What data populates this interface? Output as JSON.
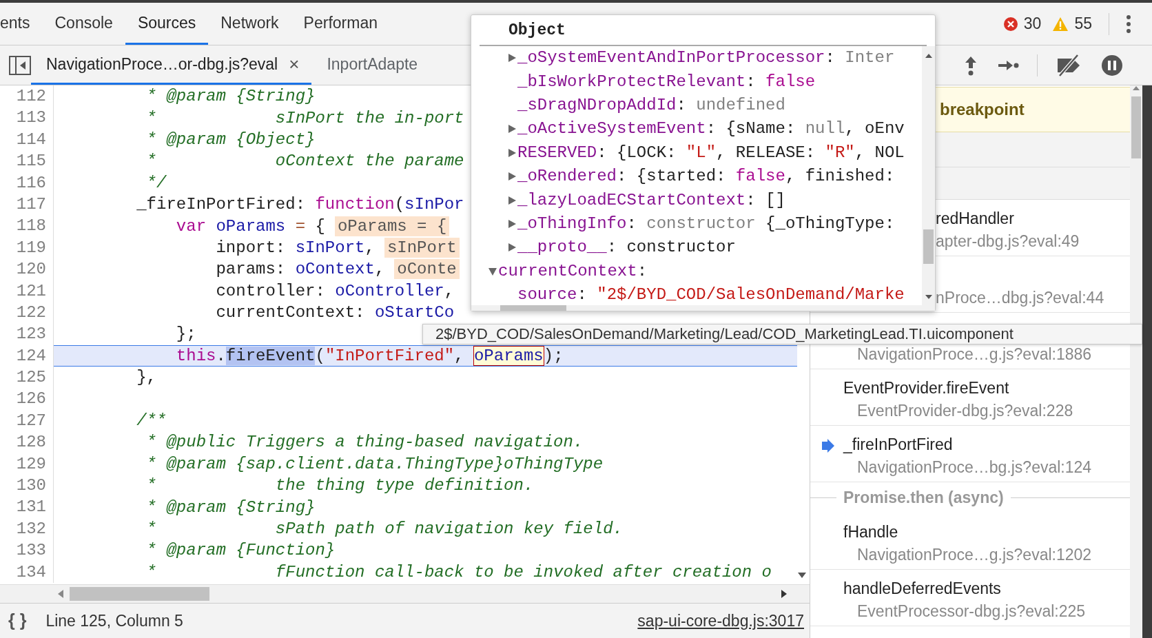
{
  "tabs": [
    {
      "label": "ents",
      "selected": false
    },
    {
      "label": "Console",
      "selected": false
    },
    {
      "label": "Sources",
      "selected": true
    },
    {
      "label": "Network",
      "selected": false
    },
    {
      "label": "Performan",
      "selected": false
    }
  ],
  "counters": {
    "errors": "30",
    "warnings": "55"
  },
  "file_tabs": [
    {
      "label": "NavigationProce…or-dbg.js?eval",
      "selected": true,
      "close": "×"
    },
    {
      "label": "InportAdapte",
      "selected": false
    }
  ],
  "editor": {
    "lines": [
      {
        "number": "112",
        "current": false,
        "tokens": [
          {
            "kind": "comment",
            "text": "         * @param {String}"
          }
        ]
      },
      {
        "number": "113",
        "current": false,
        "tokens": [
          {
            "kind": "comment",
            "text": "         *            sInPort the in-port"
          }
        ]
      },
      {
        "number": "114",
        "current": false,
        "tokens": [
          {
            "kind": "comment",
            "text": "         * @param {Object}"
          }
        ]
      },
      {
        "number": "115",
        "current": false,
        "tokens": [
          {
            "kind": "comment",
            "text": "         *            oContext the parame"
          }
        ]
      },
      {
        "number": "116",
        "current": false,
        "tokens": [
          {
            "kind": "comment",
            "text": "         */"
          }
        ]
      },
      {
        "number": "117",
        "current": false,
        "tokens": [
          {
            "kind": "plain",
            "text": "        _fireInPortFired: "
          },
          {
            "kind": "keyword",
            "text": "function"
          },
          {
            "kind": "plain",
            "text": "("
          },
          {
            "kind": "def",
            "text": "sInPor"
          }
        ]
      },
      {
        "number": "118",
        "current": false,
        "tokens": [
          {
            "kind": "keyword",
            "text": "            var"
          },
          {
            "kind": "def",
            "text": " oParams"
          },
          {
            "kind": "op",
            "text": " = "
          },
          {
            "kind": "plain",
            "text": "{"
          }
        ],
        "inline_value": "oParams = {"
      },
      {
        "number": "119",
        "current": false,
        "tokens": [
          {
            "kind": "plain",
            "text": "                inport: "
          },
          {
            "kind": "def",
            "text": "sInPort"
          },
          {
            "kind": "plain",
            "text": ","
          }
        ],
        "inline_value": "sInPort"
      },
      {
        "number": "120",
        "current": false,
        "tokens": [
          {
            "kind": "plain",
            "text": "                params: "
          },
          {
            "kind": "def",
            "text": "oContext"
          },
          {
            "kind": "plain",
            "text": ","
          }
        ],
        "inline_value": "oConte"
      },
      {
        "number": "121",
        "current": false,
        "tokens": [
          {
            "kind": "plain",
            "text": "                controller: "
          },
          {
            "kind": "def",
            "text": "oController"
          },
          {
            "kind": "plain",
            "text": ","
          }
        ]
      },
      {
        "number": "122",
        "current": false,
        "tokens": [
          {
            "kind": "plain",
            "text": "                currentContext: "
          },
          {
            "kind": "def",
            "text": "oStartCo"
          }
        ]
      },
      {
        "number": "123",
        "current": false,
        "tokens": [
          {
            "kind": "plain",
            "text": "            };"
          }
        ]
      },
      {
        "number": "124",
        "current": true,
        "tokens": [
          {
            "kind": "keyword",
            "text": "            this"
          },
          {
            "kind": "plain",
            "text": "."
          },
          {
            "kind": "match",
            "text": "fireEvent"
          },
          {
            "kind": "plain",
            "text": "("
          },
          {
            "kind": "string",
            "text": "\"InPortFired\""
          },
          {
            "kind": "plain",
            "text": ", "
          },
          {
            "kind": "hover",
            "text": "oParams"
          },
          {
            "kind": "plain",
            "text": ");"
          }
        ]
      },
      {
        "number": "125",
        "current": false,
        "tokens": [
          {
            "kind": "plain",
            "text": "        },"
          }
        ]
      },
      {
        "number": "126",
        "current": false
      },
      {
        "number": "127",
        "current": false,
        "tokens": [
          {
            "kind": "comment",
            "text": "        /**"
          }
        ]
      },
      {
        "number": "128",
        "current": false,
        "tokens": [
          {
            "kind": "comment",
            "text": "         * @public Triggers a thing-based navigation."
          }
        ]
      },
      {
        "number": "129",
        "current": false,
        "tokens": [
          {
            "kind": "comment",
            "text": "         * @param {sap.client.data.ThingType}oThingType"
          }
        ]
      },
      {
        "number": "130",
        "current": false,
        "tokens": [
          {
            "kind": "comment",
            "text": "         *            the thing type definition."
          }
        ]
      },
      {
        "number": "131",
        "current": false,
        "tokens": [
          {
            "kind": "comment",
            "text": "         * @param {String}"
          }
        ]
      },
      {
        "number": "132",
        "current": false,
        "tokens": [
          {
            "kind": "comment",
            "text": "         *            sPath path of navigation key field."
          }
        ]
      },
      {
        "number": "133",
        "current": false,
        "tokens": [
          {
            "kind": "comment",
            "text": "         * @param {Function}"
          }
        ]
      },
      {
        "number": "134",
        "current": false,
        "tokens": [
          {
            "kind": "comment",
            "text": "         *            fFunction call-back to be invoked after creation o"
          }
        ]
      }
    ]
  },
  "status_bar": {
    "format_button": "{ }",
    "position": "Line 125, Column 5",
    "source_link": "sap-ui-core-dbg.js:3017"
  },
  "debugger": {
    "paused_banner": "breakpoint",
    "call_stack": [
      {
        "kind": "frame",
        "name": "redHandler",
        "location": "apter-dbg.js?eval:49",
        "selected": false
      },
      {
        "kind": "frame",
        "location": "nProce…dbg.js?eval:44",
        "selected": false
      },
      {
        "kind": "frame",
        "location": "NavigationProce…g.js?eval:1886",
        "selected": false
      },
      {
        "kind": "frame",
        "name": "EventProvider.fireEvent",
        "location": "EventProvider-dbg.js?eval:228",
        "selected": false
      },
      {
        "kind": "frame",
        "name": "_fireInPortFired",
        "location": "NavigationProce…bg.js?eval:124",
        "selected": true
      },
      {
        "kind": "async",
        "label": "Promise.then (async)"
      },
      {
        "kind": "frame",
        "name": "fHandle",
        "location": "NavigationProce…g.js?eval:1202",
        "selected": false
      },
      {
        "kind": "frame",
        "name": "handleDeferredEvents",
        "location": "EventProcessor-dbg.js?eval:225",
        "selected": false
      }
    ]
  },
  "popover": {
    "title": "Object",
    "tree": [
      {
        "children": [
          {
            "key": "_oSystemEventAndInPortProcessor",
            "expanded": false,
            "value": [
              {
                "kind": "plain",
                "text": ": "
              },
              {
                "kind": "dim",
                "text": "Inter"
              }
            ]
          },
          {
            "key": "_bIsWorkProtectRelevant",
            "value": [
              {
                "kind": "plain",
                "text": ": "
              },
              {
                "kind": "keyword",
                "text": "false"
              }
            ]
          },
          {
            "key": "_sDragNDropAddId",
            "value": [
              {
                "kind": "plain",
                "text": ": "
              },
              {
                "kind": "dim",
                "text": "undefined"
              }
            ]
          },
          {
            "key": "_oActiveSystemEvent",
            "expanded": false,
            "value": [
              {
                "kind": "plain",
                "text": ": {sName: "
              },
              {
                "kind": "dim",
                "text": "null"
              },
              {
                "kind": "plain",
                "text": ", oEnv"
              }
            ]
          },
          {
            "key": "RESERVED",
            "expanded": false,
            "value": [
              {
                "kind": "plain",
                "text": ": {LOCK: "
              },
              {
                "kind": "string",
                "text": "\"L\""
              },
              {
                "kind": "plain",
                "text": ", RELEASE: "
              },
              {
                "kind": "string",
                "text": "\"R\""
              },
              {
                "kind": "plain",
                "text": ", NOL"
              }
            ]
          },
          {
            "key": "_oRendered",
            "expanded": false,
            "value": [
              {
                "kind": "plain",
                "text": ": {started: "
              },
              {
                "kind": "keyword",
                "text": "false"
              },
              {
                "kind": "plain",
                "text": ", finished:"
              }
            ]
          },
          {
            "key": "_lazyLoadECStartContext",
            "expanded": false,
            "value": [
              {
                "kind": "plain",
                "text": ": []"
              }
            ]
          },
          {
            "key": "_oThingInfo",
            "expanded": false,
            "value": [
              {
                "kind": "plain",
                "text": ": "
              },
              {
                "kind": "dim",
                "text": "constructor"
              },
              {
                "kind": "plain",
                "text": " {_oThingType:"
              }
            ]
          },
          {
            "key": "__proto__",
            "expanded": false,
            "value": [
              {
                "kind": "plain",
                "text": ": constructor"
              }
            ]
          }
        ]
      },
      {
        "key": "currentContext",
        "expanded": true,
        "value": [
          {
            "kind": "plain",
            "text": ":"
          }
        ],
        "children": [
          {
            "key": "source",
            "value": [
              {
                "kind": "plain",
                "text": ": "
              },
              {
                "kind": "string",
                "text": "\"2$/BYD_COD/SalesOnDemand/Marke"
              }
            ]
          }
        ]
      }
    ]
  },
  "tooltip": "2$/BYD_COD/SalesOnDemand/Marketing/Lead/COD_MarketingLead.TI.uicomponent"
}
